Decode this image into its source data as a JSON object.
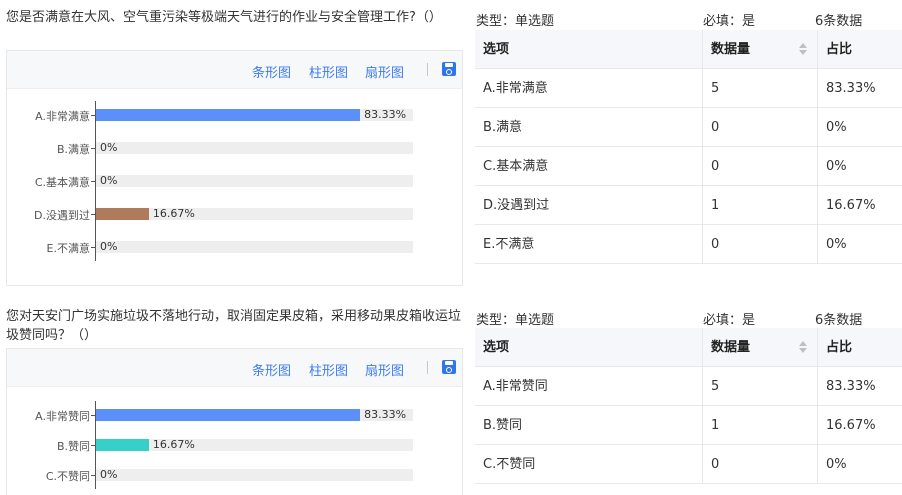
{
  "toolbar": {
    "bar_label": "条形图",
    "column_label": "柱形图",
    "pie_label": "扇形图"
  },
  "questions": [
    {
      "title": "您是否满意在大风、空气重污染等极端天气进行的作业与安全管理工作?（）",
      "type_text": "类型：单选题",
      "required_text": "必填：是",
      "count_text": "6条数据",
      "table_headers": [
        "选项",
        "数据量",
        "占比"
      ],
      "rows": [
        {
          "option": "A.非常满意",
          "count": "5",
          "percent": "83.33%"
        },
        {
          "option": "B.满意",
          "count": "0",
          "percent": "0%"
        },
        {
          "option": "C.基本满意",
          "count": "0",
          "percent": "0%"
        },
        {
          "option": "D.没遇到过",
          "count": "1",
          "percent": "16.67%"
        },
        {
          "option": "E.不满意",
          "count": "0",
          "percent": "0%"
        }
      ],
      "chart_data": {
        "type": "bar",
        "categories": [
          "A.非常满意",
          "B.满意",
          "C.基本满意",
          "D.没遇到过",
          "E.不满意"
        ],
        "values": [
          83.33,
          0,
          0,
          16.67,
          0
        ],
        "value_labels": [
          "83.33%",
          "0%",
          "0%",
          "16.67%",
          "0%"
        ],
        "colors": [
          "#5b8ff9",
          "#5b8ff9",
          "#5b8ff9",
          "#b07a5c",
          "#5b8ff9"
        ],
        "xlim": [
          0,
          100
        ],
        "grid": false
      }
    },
    {
      "title": "您对天安门广场实施垃圾不落地行动，取消固定果皮箱，采用移动果皮箱收运垃圾赞同吗？（）",
      "type_text": "类型：单选题",
      "required_text": "必填：是",
      "count_text": "6条数据",
      "table_headers": [
        "选项",
        "数据量",
        "占比"
      ],
      "rows": [
        {
          "option": "A.非常赞同",
          "count": "5",
          "percent": "83.33%"
        },
        {
          "option": "B.赞同",
          "count": "1",
          "percent": "16.67%"
        },
        {
          "option": "C.不赞同",
          "count": "0",
          "percent": "0%"
        }
      ],
      "chart_data": {
        "type": "bar",
        "categories": [
          "A.非常赞同",
          "B.赞同",
          "C.不赞同"
        ],
        "values": [
          83.33,
          16.67,
          0
        ],
        "value_labels": [
          "83.33%",
          "16.67%",
          "0%"
        ],
        "colors": [
          "#5b8ff9",
          "#36cfc9",
          "#5b8ff9"
        ],
        "xlim": [
          0,
          100
        ],
        "grid": false
      }
    }
  ]
}
